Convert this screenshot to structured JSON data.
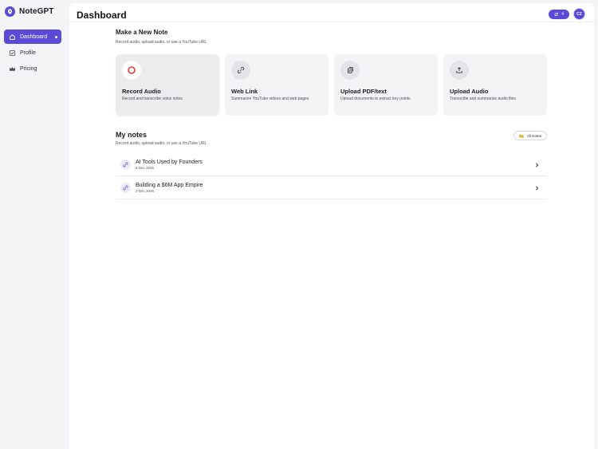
{
  "brand": {
    "name": "NoteGPT"
  },
  "sidebar": {
    "items": [
      {
        "label": "Dashboard",
        "icon": "home-icon"
      },
      {
        "label": "Profile",
        "icon": "checkbox-icon"
      },
      {
        "label": "Pricing",
        "icon": "crown-icon"
      }
    ]
  },
  "header": {
    "title": "Dashboard",
    "credits": "4",
    "avatar": "CZ"
  },
  "new_note": {
    "title": "Make a New Note",
    "subtitle": "Record audio, upload audio, or use a YouTube URL",
    "cards": [
      {
        "title": "Record Audio",
        "desc": "Record and transcribe voice notes",
        "icon": "record-icon"
      },
      {
        "title": "Web Link",
        "desc": "Summarize YouTube videos and web pages",
        "icon": "link-icon"
      },
      {
        "title": "Upload PDF/text",
        "desc": "Upload documents to extract key points",
        "icon": "document-icon"
      },
      {
        "title": "Upload Audio",
        "desc": "Transcribe and summarize audio files",
        "icon": "upload-icon"
      }
    ]
  },
  "my_notes": {
    "title": "My notes",
    "subtitle": "Record audio, upload audio, or use a YouTube URL",
    "all_notes_label": "All Notes",
    "notes": [
      {
        "title": "AI Tools Used by Founders",
        "date": "8 Dec 2025"
      },
      {
        "title": "Building a $6M App Empire",
        "date": "2 Dec 2025"
      }
    ]
  },
  "colors": {
    "accent": "#5a4bd6",
    "record": "#e03b3b",
    "background": "#f4f4f6"
  }
}
